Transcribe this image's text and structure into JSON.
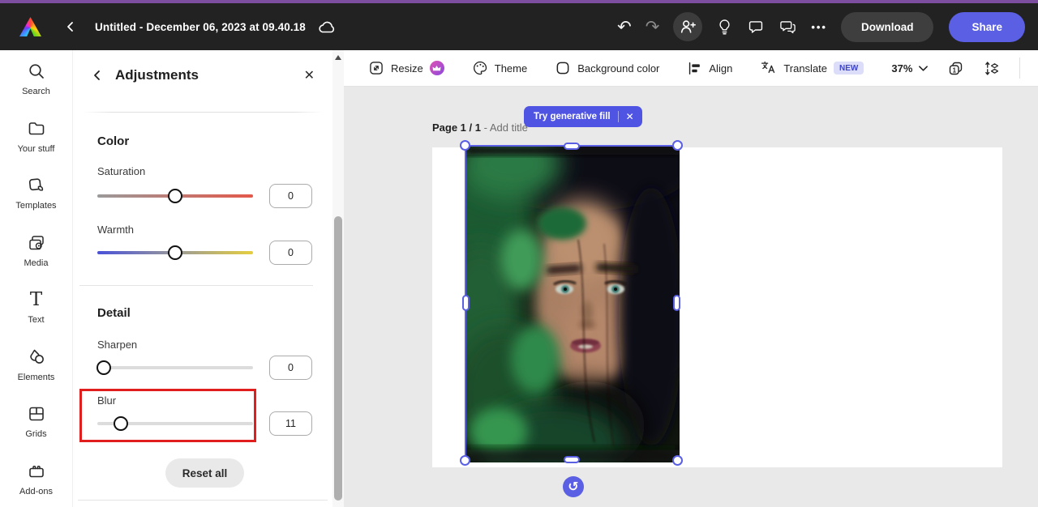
{
  "topbar": {
    "title": "Untitled - December 06, 2023 at 09.40.18",
    "download_label": "Download",
    "share_label": "Share",
    "more_glyph": "•••"
  },
  "icons": {
    "undo": "↶",
    "redo": "↷",
    "rotate": "↺",
    "close": "✕",
    "text_glyph": "T"
  },
  "sidebar": {
    "items": [
      {
        "label": "Search"
      },
      {
        "label": "Your stuff"
      },
      {
        "label": "Templates"
      },
      {
        "label": "Media"
      },
      {
        "label": "Text"
      },
      {
        "label": "Elements"
      },
      {
        "label": "Grids"
      },
      {
        "label": "Add-ons"
      }
    ]
  },
  "panel": {
    "title": "Adjustments",
    "section_color": "Color",
    "section_detail": "Detail",
    "sliders": [
      {
        "label": "Saturation",
        "value": "0",
        "percent": "50%"
      },
      {
        "label": "Warmth",
        "value": "0",
        "percent": "50%"
      },
      {
        "label": "Sharpen",
        "value": "0",
        "percent": "4%"
      },
      {
        "label": "Blur",
        "value": "11",
        "percent": "15%"
      }
    ],
    "reset_label": "Reset all"
  },
  "toolbar": {
    "resize_label": "Resize",
    "theme_label": "Theme",
    "background_label": "Background color",
    "align_label": "Align",
    "translate_label": "Translate",
    "new_badge": "NEW",
    "zoom_level": "37%",
    "page_number": "1"
  },
  "canvas": {
    "tooltip_label": "Try generative fill",
    "page_indicator": "Page 1 / 1",
    "add_title_label": "- Add title"
  },
  "colors": {
    "accent_indigo": "#5A5FE3",
    "topbar_purple": "#7D4DA0",
    "highlight_red": "#E11E1E",
    "saturation_gradient": [
      "#9A9A9A",
      "#E4584A"
    ],
    "warmth_gradient": [
      "#4A52D8",
      "#999999",
      "#E5CF3F"
    ]
  }
}
